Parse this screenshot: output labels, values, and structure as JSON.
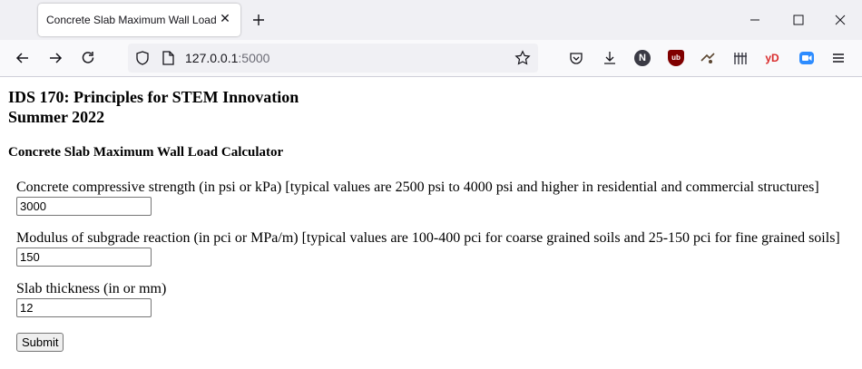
{
  "browser": {
    "tab_title": "Concrete Slab Maximum Wall Load",
    "url_host": "127.0.0.1",
    "url_port": ":5000",
    "extensions": [
      {
        "name": "pocket-icon",
        "label": ""
      },
      {
        "name": "downloads-icon",
        "label": ""
      },
      {
        "name": "n-extension-icon",
        "label": "N"
      },
      {
        "name": "ublock-icon",
        "label": "ub"
      },
      {
        "name": "extension-icon",
        "label": ""
      },
      {
        "name": "extension-bars-icon",
        "label": ""
      },
      {
        "name": "yd-extension-icon",
        "label": "yD"
      },
      {
        "name": "zoom-icon",
        "label": ""
      }
    ]
  },
  "page": {
    "heading_line1": "IDS 170: Principles for STEM Innovation",
    "heading_line2": "Summer 2022",
    "subheading": "Concrete Slab Maximum Wall Load Calculator",
    "fields": [
      {
        "label": "Concrete compressive strength (in psi or kPa) [typical values are 2500 psi to 4000 psi and higher in residential and commercial structures]",
        "value": "3000"
      },
      {
        "label": "Modulus of subgrade reaction (in pci or MPa/m) [typical values are 100-400 pci for coarse grained soils and 25-150 pci for fine grained soils]",
        "value": "150"
      },
      {
        "label": "Slab thickness (in or mm)",
        "value": "12"
      }
    ],
    "submit_label": "Submit"
  }
}
